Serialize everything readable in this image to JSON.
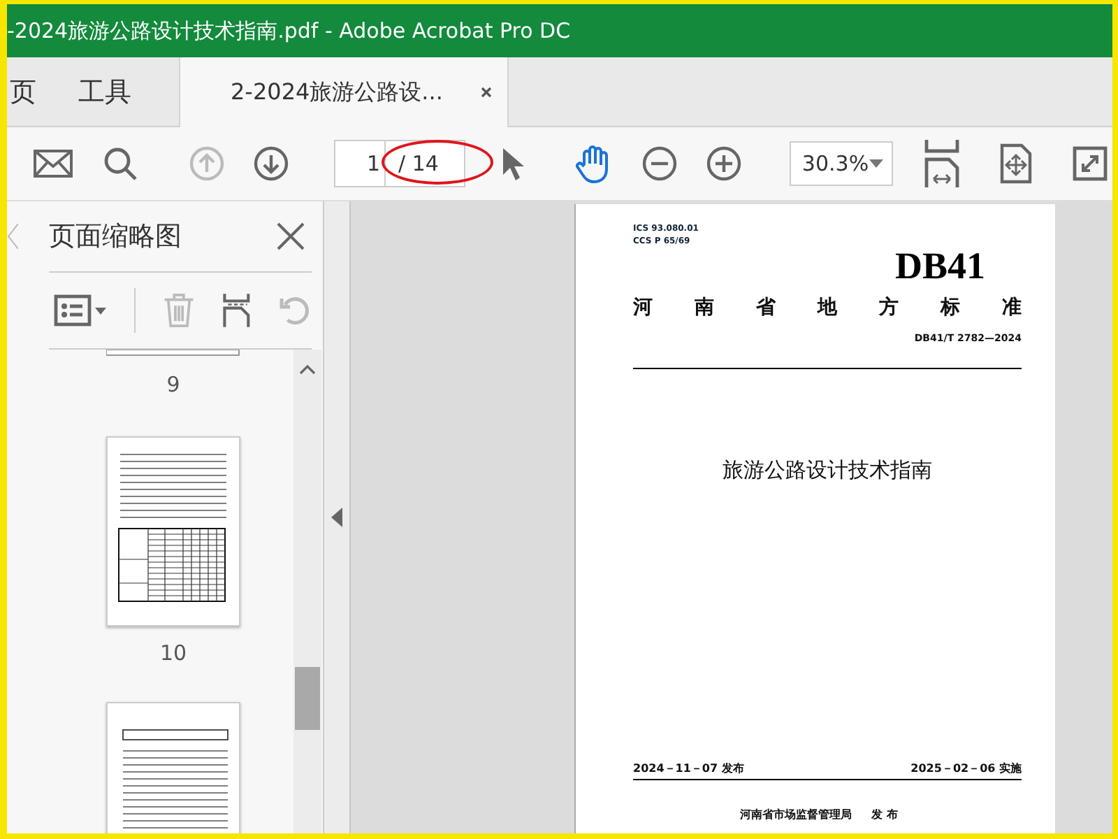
{
  "window": {
    "title": "-2024旅游公路设计技术指南.pdf - Adobe Acrobat Pro DC"
  },
  "tabs": [
    {
      "label": "页",
      "selected": false
    },
    {
      "label": "工具",
      "selected": false
    },
    {
      "label": "2-2024旅游公路设...",
      "selected": true
    }
  ],
  "toolbar": {
    "prev_page": {
      "disabled": true
    },
    "next_page": {
      "disabled": false
    },
    "page_field": {
      "value": "1",
      "total": "/ 14"
    },
    "zoom": {
      "value": "30.3%"
    }
  },
  "sidebar": {
    "title": "页面缩略图",
    "delete": {
      "disabled": true
    },
    "rotate": {
      "disabled": true
    },
    "thumbnails": [
      {
        "kind": "tail",
        "label": "9"
      },
      {
        "kind": "table",
        "label": "10"
      },
      {
        "kind": "text"
      }
    ]
  },
  "document": {
    "ics": "ICS  93.080.01",
    "ccs": "CCS  P 65/69",
    "code": "DB41",
    "heading": "河南省地方标准",
    "number": "DB41/T 2782—2024",
    "title": "旅游公路设计技术指南",
    "publish_date": "2024－11－07 发布",
    "effective_date": "2025－02－06 实施",
    "issuer": "河南省市场监督管理局",
    "issue": "发 布"
  }
}
